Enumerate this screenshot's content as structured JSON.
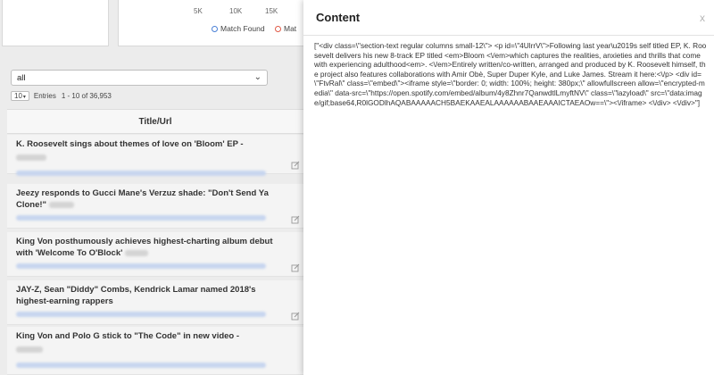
{
  "chart": {
    "ticks": [
      "5K",
      "10K",
      "15K"
    ],
    "partial_tick": "K",
    "legend": [
      {
        "label": "Match Found",
        "color": "#4a80d6"
      },
      {
        "label": "Mat",
        "color": "#e05a47"
      }
    ]
  },
  "filter": {
    "value": "all"
  },
  "pagination": {
    "page_size": "10",
    "entries_label": "Entries",
    "info": "1 - 10 of 36,953"
  },
  "table": {
    "column": "Title/Url",
    "rows": [
      {
        "title": "K. Roosevelt sings about themes of love on 'Bloom' EP -"
      },
      {
        "title": "Jeezy responds to Gucci Mane's Verzuz shade: \"Don't Send Ya Clone!\""
      },
      {
        "title": "King Von posthumously achieves highest-charting album debut with 'Welcome To O'Block'"
      },
      {
        "title": "JAY-Z, Sean \"Diddy\" Combs, Kendrick Lamar named 2018's highest-earning rappers"
      },
      {
        "title": "King Von and Polo G stick to \"The Code\" in new video -"
      }
    ]
  },
  "modal": {
    "title": "Content",
    "close": "x",
    "body": "[\"<div class=\\\"section-text regular columns small-12\\\"> <p id=\\\"4UlrrV\\\">Following last year\\u2019s self titled EP, K. Roosevelt delivers his new 8-track EP titled <em>Bloom <\\/em>which captures the realities, anxieties and thrills that come with experiencing adulthood<em>. <\\/em>Entirely written/co-written, arranged and produced by K. Roosevelt himself, the project also features collaborations with Amir Obè, Super Duper Kyle, and Luke James. Stream it here:<\\/p> <div id=\\\"FtvRal\\\" class=\\\"embed\\\"><iframe style=\\\"border: 0; width: 100%; height: 380px;\\\" allowfullscreen allow=\\\"encrypted-media\\\" data-src=\\\"https://open.spotify.com/embed/album/4y8Zhnr7QanwdtlLmyftNV\\\" class=\\\"lazyload\\\" src=\\\"data:image/gif;base64,R0lGODlhAQABAAAAACH5BAEKAAEALAAAAAABAAEAAAICTAEAOw==\\\"><\\/iframe> <\\/div> <\\/div>\"]"
  }
}
